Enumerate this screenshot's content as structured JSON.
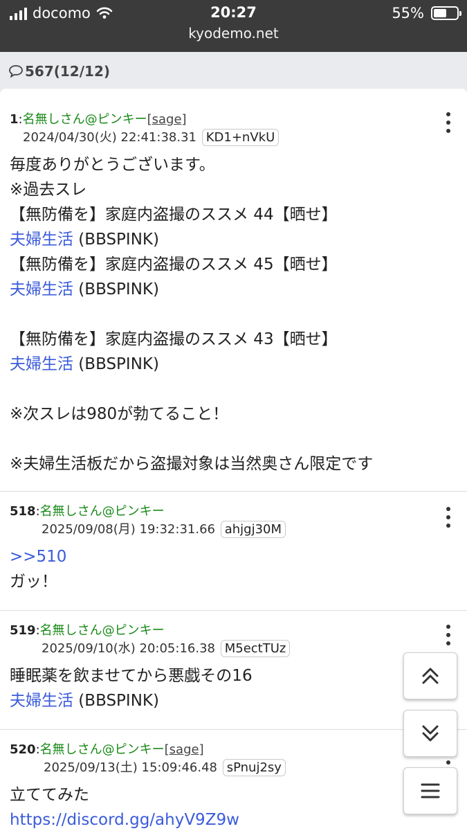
{
  "status_bar": {
    "carrier": "docomo",
    "time": "20:27",
    "battery": "55%",
    "battery_level": 0.55,
    "url": "kyodemo.net"
  },
  "thread_info": {
    "count_label": "567(12/12)"
  },
  "posts": [
    {
      "number": "1",
      "name": "名無しさん@ピンキー",
      "sage": "[sage]",
      "datetime": "2024/04/30(火) 22:41:38.31",
      "uid": "KD1+nVkU",
      "lines": [
        {
          "text": "毎度ありがとうございます。"
        },
        {
          "text": "※過去スレ"
        },
        {
          "text": "【無防備を】家庭内盗撮のススメ 44【晒せ】"
        },
        {
          "link": "夫婦生活",
          "suffix": " (BBSPINK)"
        },
        {
          "text": "【無防備を】家庭内盗撮のススメ 45【晒せ】"
        },
        {
          "link": "夫婦生活",
          "suffix": " (BBSPINK)"
        },
        {
          "text": ""
        },
        {
          "text": "【無防備を】家庭内盗撮のススメ 43【晒せ】"
        },
        {
          "link": "夫婦生活",
          "suffix": " (BBSPINK)"
        },
        {
          "text": ""
        },
        {
          "text": "※次スレは980が勃てること！"
        },
        {
          "text": ""
        },
        {
          "text": "※夫婦生活板だから盗撮対象は当然奥さん限定です"
        }
      ]
    },
    {
      "number": "518",
      "name": "名無しさん@ピンキー",
      "sage": "",
      "datetime": "2025/09/08(月) 19:32:31.66",
      "uid": "ahjgj30M",
      "lines": [
        {
          "link": ">>510",
          "suffix": ""
        },
        {
          "text": "ガッ！"
        }
      ]
    },
    {
      "number": "519",
      "name": "名無しさん@ピンキー",
      "sage": "",
      "datetime": "2025/09/10(水) 20:05:16.38",
      "uid": "M5ectTUz",
      "lines": [
        {
          "text": "睡眠薬を飲ませてから悪戯その16"
        },
        {
          "link": "夫婦生活",
          "suffix": " (BBSPINK)"
        }
      ]
    },
    {
      "number": "520",
      "name": "名無しさん@ピンキー",
      "sage": "[sage]",
      "datetime": "2025/09/13(土) 15:09:46.48",
      "uid": "sPnuj2sy",
      "lines": [
        {
          "text": "立ててみた"
        },
        {
          "link": "https://discord.gg/ahyV9Z9w",
          "suffix": ""
        }
      ]
    }
  ],
  "icons": {
    "scroll_top": "double-chevron-up-icon",
    "scroll_bottom": "double-chevron-down-icon",
    "menu": "hamburger-menu-icon",
    "post_menu": "kebab-icon",
    "comment": "speech-bubble-icon"
  },
  "colors": {
    "status_bar_bg": "#3b3b3b",
    "name_green": "#1a8a1a",
    "link_blue": "#3b5bdb"
  }
}
